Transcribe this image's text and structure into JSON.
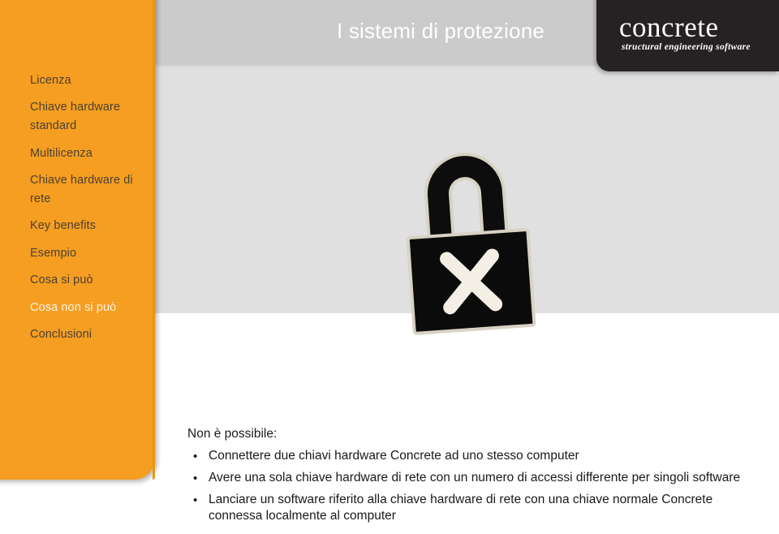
{
  "slide": {
    "title": "I sistemi di protezione"
  },
  "logo": {
    "wordmark": "concrete",
    "tagline": "structural engineering software"
  },
  "sidebar": {
    "items": [
      {
        "label": "Licenza",
        "active": false
      },
      {
        "label": "Chiave hardware standard",
        "active": false
      },
      {
        "label": "Multilicenza",
        "active": false
      },
      {
        "label": "Chiave hardware di rete",
        "active": false
      },
      {
        "label": "Key benefits",
        "active": false
      },
      {
        "label": "Esempio",
        "active": false
      },
      {
        "label": "Cosa si può",
        "active": false
      },
      {
        "label": "Cosa non si può",
        "active": true
      },
      {
        "label": "Conclusioni",
        "active": false
      }
    ]
  },
  "graphic": {
    "name": "padlock-with-x-icon",
    "description": "black padlock with white cross"
  },
  "body": {
    "lead": "Non è possibile:",
    "bullets": [
      "Connettere due chiavi hardware Concrete ad uno stesso computer",
      "Avere una sola chiave hardware di rete con un numero di accessi differente per singoli software",
      "Lanciare un software riferito alla chiave hardware di rete con una chiave normale Concrete connessa localmente al computer"
    ],
    "bullet_glyph": "•"
  },
  "colors": {
    "sidebar_orange": "#f59e21",
    "title_bar_grey": "#cbcbcb",
    "content_grey": "#e0e0e0",
    "logo_dark": "#262223",
    "active_nav": "#fdf3e4",
    "nav_text": "#4c4134"
  }
}
